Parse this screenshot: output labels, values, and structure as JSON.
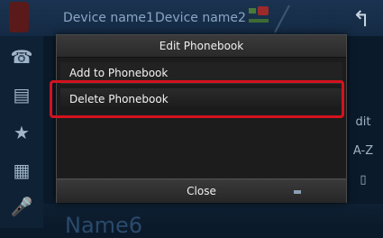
{
  "header": {
    "device1": "Device name1",
    "device2": "Device name2",
    "back_icon": "back-arrow-icon"
  },
  "sidebar": {
    "items": [
      {
        "icon": "phone-icon"
      },
      {
        "icon": "phonebook-icon"
      },
      {
        "icon": "star-icon"
      },
      {
        "icon": "keypad-icon"
      },
      {
        "icon": "voice-icon"
      }
    ]
  },
  "background": {
    "right_labels": [
      "dit",
      "A-Z"
    ],
    "bottom_name": "Name6"
  },
  "dialog": {
    "title": "Edit Phonebook",
    "items": [
      {
        "label": "Add to Phonebook"
      },
      {
        "label": "Delete Phonebook"
      }
    ],
    "close_label": "Close"
  },
  "colors": {
    "highlight": "#d4121e",
    "dialog_bg": "#1c1c1c"
  }
}
